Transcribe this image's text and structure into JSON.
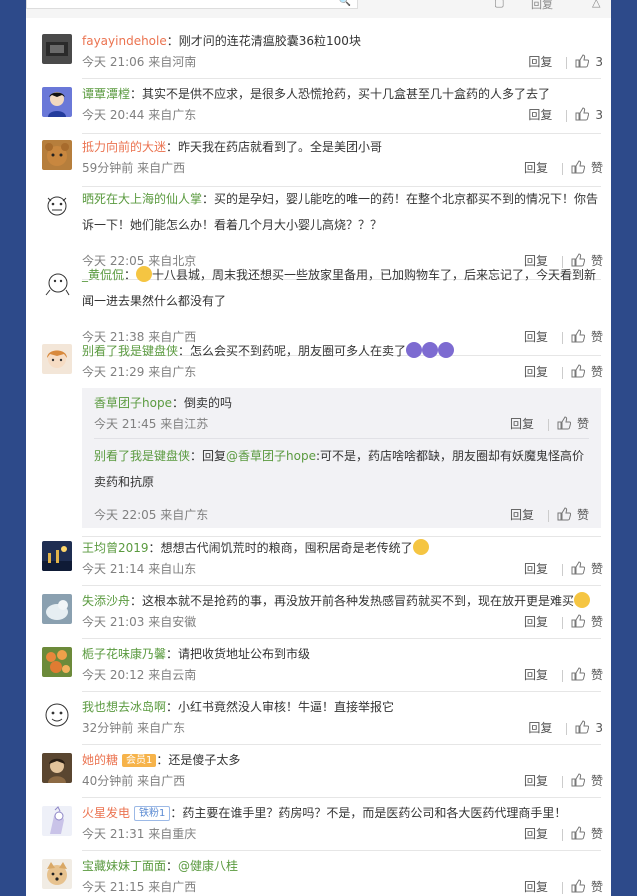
{
  "top": {
    "reply_label": "回复"
  },
  "comments": [
    {
      "user": "fayayindehole",
      "text": "刚才问的连花清瘟胶囊36粒100块",
      "time": "今天 21:06 来自河南",
      "reply": "回复",
      "likes": "3"
    },
    {
      "user": "谭覃潭樘",
      "text": "其实不是供不应求，是很多人恐慌抢药，买十几盒甚至几十盒药的人多了去了",
      "time": "今天 20:44 来自广东",
      "reply": "回复",
      "likes": "3"
    },
    {
      "user": "抵力向前的大迷",
      "text": "昨天我在药店就看到了。全是美团小哥",
      "time": "59分钟前 来自广西",
      "reply": "回复",
      "likes": "赞"
    },
    {
      "user": "晒死在大上海的仙人掌",
      "text": "买的是孕妇，婴儿能吃的唯一的药！在整个北京都买不到的情况下！你告诉一下！她们能怎么办！看着几个月大小婴儿高烧？？？",
      "time": "今天 22:05 来自北京",
      "reply": "回复",
      "likes": "赞"
    },
    {
      "user": "_黄侃侃",
      "text": "十八县城，周末我还想买一些放家里备用，已加购物车了，后来忘记了，今天看到新闻一进去果然什么都没有了",
      "time": "今天 21:38 来自广西",
      "reply": "回复",
      "likes": "赞"
    },
    {
      "user": "别看了我是键盘侠",
      "text": "怎么会买不到药呢，朋友圈可多人在卖了",
      "time": "今天 21:29 来自广东",
      "reply": "回复",
      "likes": "赞",
      "subs": [
        {
          "user": "香草团子hope",
          "text": "倒卖的吗",
          "time": "今天 21:45 来自江苏",
          "reply": "回复",
          "likes": "赞"
        },
        {
          "user": "别看了我是键盘侠",
          "text": "回复",
          "mention": "@香草团子hope",
          "text2": ":可不是，药店啥啥都缺，朋友圈却有妖魔鬼怪高价卖药和抗原",
          "time": "今天 22:05 来自广东",
          "reply": "回复",
          "likes": "赞"
        }
      ]
    },
    {
      "user": "王均曾2019",
      "text": "想想古代闹饥荒时的粮商，囤积居奇是老传统了",
      "time": "今天 21:14 来自山东",
      "reply": "回复",
      "likes": "赞"
    },
    {
      "user": "失添沙舟",
      "text": "这根本就不是抢药的事，再没放开前各种发热感冒药就买不到，现在放开更是难买",
      "time": "今天 21:03 来自安徽",
      "reply": "回复",
      "likes": "赞"
    },
    {
      "user": "栀子花味康乃馨",
      "text": "请把收货地址公布到市级",
      "time": "今天 20:12 来自云南",
      "reply": "回复",
      "likes": "赞"
    },
    {
      "user": "我也想去冰岛啊",
      "text": "小红书竟然没人审核！牛逼！直接举报它",
      "time": "32分钟前 来自广东",
      "reply": "回复",
      "likes": "3"
    },
    {
      "user": "她的糖",
      "badge": "会员1",
      "text": "还是傻子太多",
      "time": "40分钟前 来自广西",
      "reply": "回复",
      "likes": "赞"
    },
    {
      "user": "火星发电",
      "badge": "铁粉1",
      "text": "药主要在谁手里？药房吗？不是，而是医药公司和各大医药代理商手里！",
      "time": "今天 21:31 来自重庆",
      "reply": "回复",
      "likes": "赞"
    },
    {
      "user": "宝藏妹妹丁面面",
      "text": "@健康八桂",
      "time": "今天 21:15 来自广西",
      "reply": "回复",
      "likes": "赞"
    }
  ],
  "colors": {
    "accent": "#eb7350",
    "green_name": "#5a9a3f",
    "page_bg": "#2d4a8a"
  }
}
